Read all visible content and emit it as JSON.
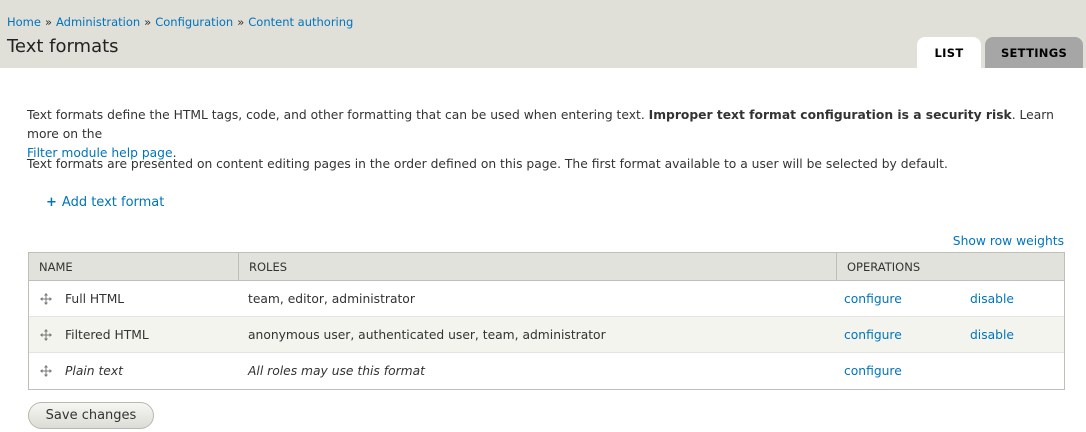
{
  "breadcrumb": {
    "items": [
      "Home",
      "Administration",
      "Configuration",
      "Content authoring"
    ],
    "separator": "»"
  },
  "page": {
    "title": "Text formats"
  },
  "tabs": {
    "list": "LIST",
    "settings": "SETTINGS",
    "active": "LIST"
  },
  "intro": {
    "p1_text": "Text formats define the HTML tags, code, and other formatting that can be used when entering text. ",
    "p1_bold": "Improper text format configuration is a security risk",
    "p1_after": ". Learn more on the ",
    "p1_link": "Filter module help page",
    "p1_end": ".",
    "p2": "Text formats are presented on content editing pages in the order defined on this page. The first format available to a user will be selected by default."
  },
  "actions": {
    "add_plus": "+",
    "add_label": "Add text format",
    "row_weights": "Show row weights"
  },
  "table": {
    "headers": {
      "name": "NAME",
      "roles": "ROLES",
      "operations": "OPERATIONS"
    },
    "rows": [
      {
        "name": "Full HTML",
        "roles": "team, editor, administrator",
        "configure": "configure",
        "disable": "disable"
      },
      {
        "name": "Filtered HTML",
        "roles": "anonymous user, authenticated user, team, administrator",
        "configure": "configure",
        "disable": "disable"
      },
      {
        "name": "Plain text",
        "roles": "All roles may use this format",
        "configure": "configure",
        "disable": ""
      }
    ]
  },
  "form": {
    "save_label": "Save changes"
  },
  "icons": {
    "drag": "drag-handle-icon",
    "add": "plus-icon"
  },
  "colors": {
    "link": "#0074bd",
    "header_bg": "#e0e0d8",
    "table_header_bg": "#e1e2dc",
    "row_alt": "#f3f4ee",
    "tab_inactive": "#a6a6a6"
  }
}
